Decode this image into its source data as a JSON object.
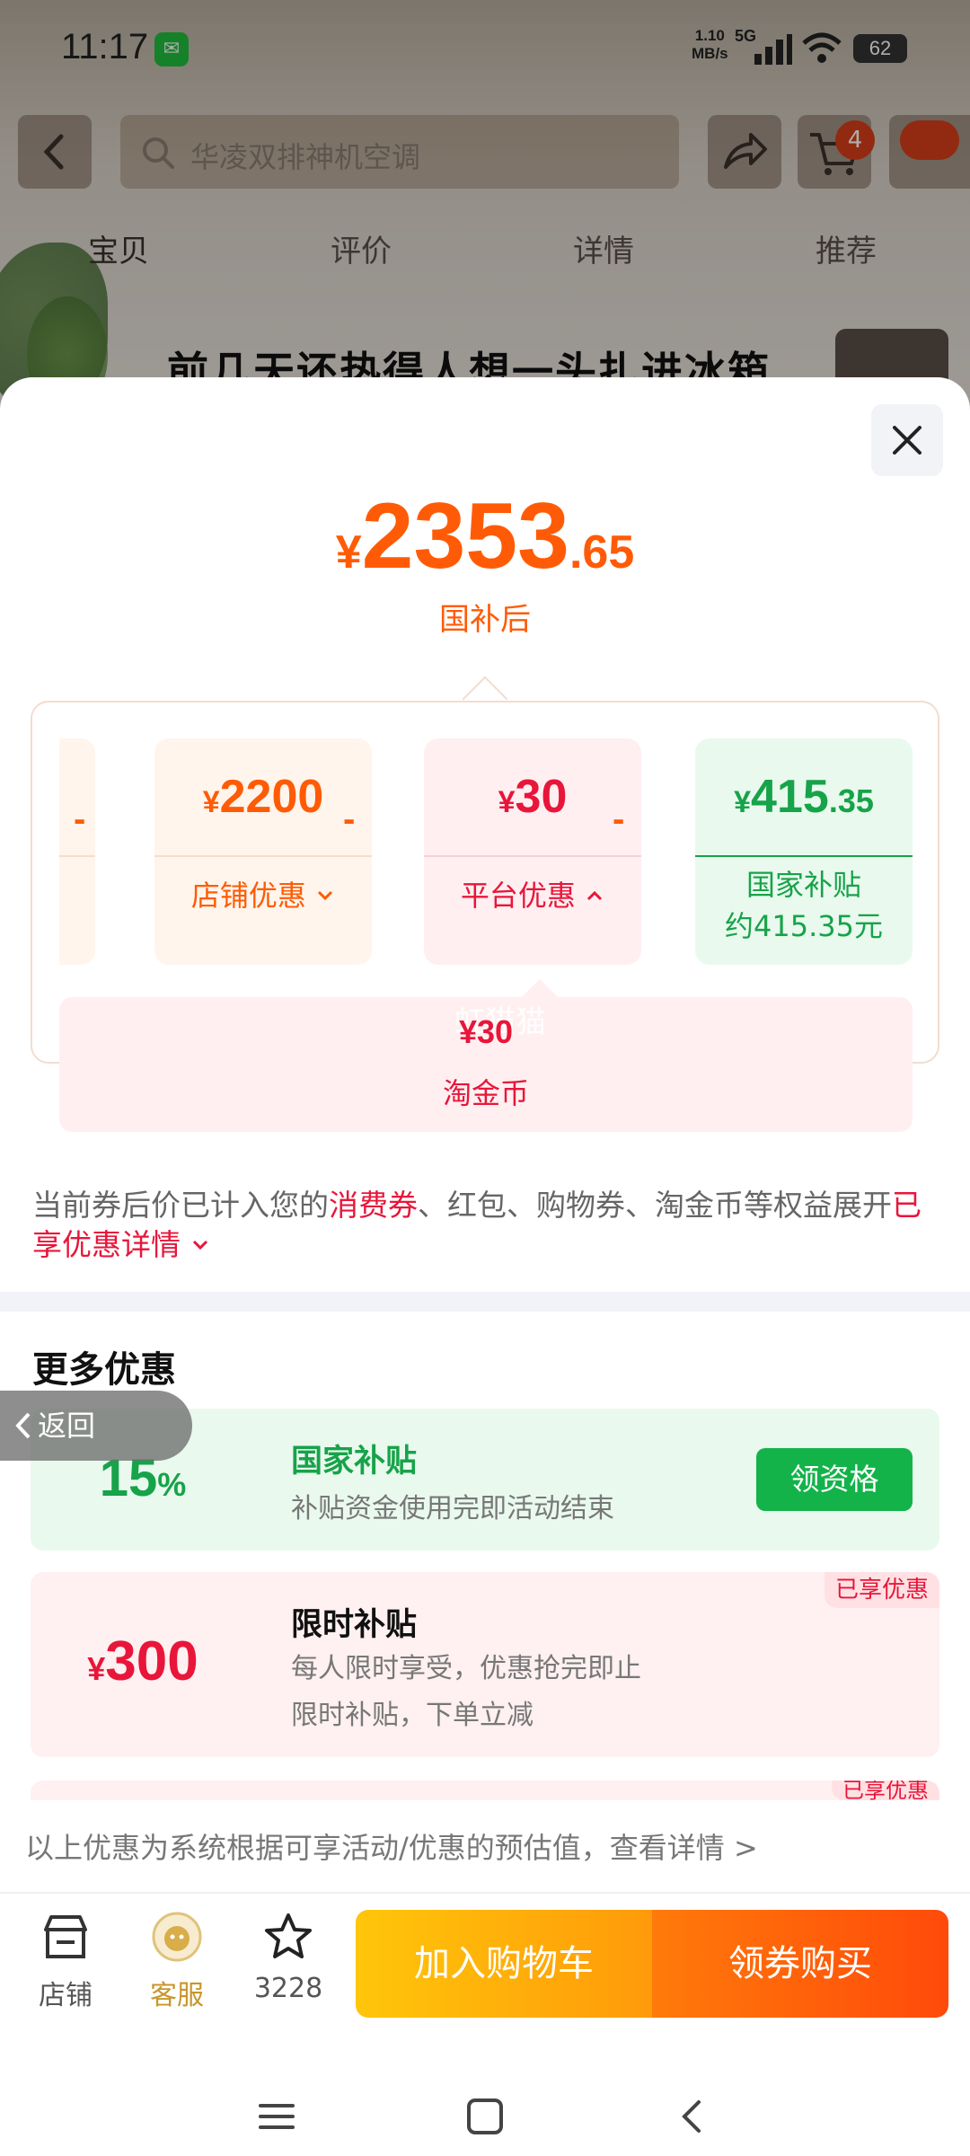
{
  "status_bar": {
    "time": "11:17",
    "net_speed": "1.10",
    "net_unit": "MB/s",
    "signal": "5G",
    "battery": "62"
  },
  "background_page": {
    "search_placeholder": "华凌双排神机空调",
    "cart_count": "4",
    "tabs": [
      "宝贝",
      "评价",
      "详情",
      "推荐"
    ],
    "headline": "前几天还热得人想一头扎进冰箱"
  },
  "sheet": {
    "price": {
      "currency": "¥",
      "integer": "2353",
      "decimal": ".65",
      "label": "国补后"
    },
    "breakdown": {
      "minus": "-",
      "shop": {
        "currency": "¥",
        "amount": "2200",
        "label": "店铺优惠"
      },
      "platform": {
        "currency": "¥",
        "amount": "30",
        "label": "平台优惠"
      },
      "gov": {
        "currency": "¥",
        "amount": "415",
        "decimal": ".35",
        "label_line1": "国家补贴",
        "label_line2": "约415.35元"
      },
      "coin": {
        "amount": "¥30",
        "label": "淘金币"
      },
      "watermark": "虹猫猫"
    },
    "description": {
      "prefix": "当前券后价已计入您的",
      "highlight": "消费券",
      "middle": "、红包、购物券、淘金币等权益展开",
      "link": "已享优惠详情"
    },
    "more_title": "更多优惠",
    "back_label": "返回",
    "offers": [
      {
        "value": "15",
        "unit": "%",
        "title": "国家补贴",
        "sub1": "补贴资金使用完即活动结束",
        "button": "领资格"
      },
      {
        "currency": "¥",
        "value": "300",
        "title": "限时补贴",
        "sub1": "每人限时享受，优惠抢完即止",
        "sub2": "限时补贴，下单立减",
        "tag": "已享优惠"
      },
      {
        "tag": "已享优惠"
      }
    ],
    "footnote": "以上优惠为系统根据可享活动/优惠的预估值，查看详情 >"
  },
  "bottom_bar": {
    "shop": "店铺",
    "service": "客服",
    "favorites": "3228",
    "add_cart": "加入购物车",
    "buy": "领券购买"
  },
  "colors": {
    "orange": "#ff5b06",
    "red": "#e8163a",
    "green": "#17a349"
  }
}
